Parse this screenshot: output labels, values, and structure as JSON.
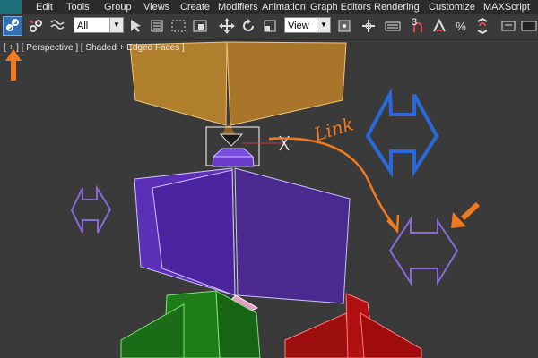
{
  "app": {
    "brand_color": "#1d6f7a"
  },
  "menu": {
    "items": [
      "Edit",
      "Tools",
      "Group",
      "Views",
      "Create",
      "Modifiers",
      "Animation",
      "Graph Editors",
      "Rendering",
      "Customize",
      "MAXScript"
    ]
  },
  "toolbar": {
    "selection_filter": "All",
    "reference_coord": "View",
    "snap_label": "3",
    "link_tool": {
      "active": true,
      "icon": "link-icon"
    }
  },
  "viewport": {
    "label": "[ + ] [ Perspective ] [ Shaded + Edged Faces ]",
    "annotation": "Link",
    "colors": {
      "orange_object": "#b07f2d",
      "purple_object": "#5b2fb6",
      "green_object": "#1f7d19",
      "red_object": "#b01010",
      "annotation_orange": "#f07a1d",
      "annotation_blue": "#2a6ad8",
      "annotation_purple": "#8a6ad8"
    }
  }
}
